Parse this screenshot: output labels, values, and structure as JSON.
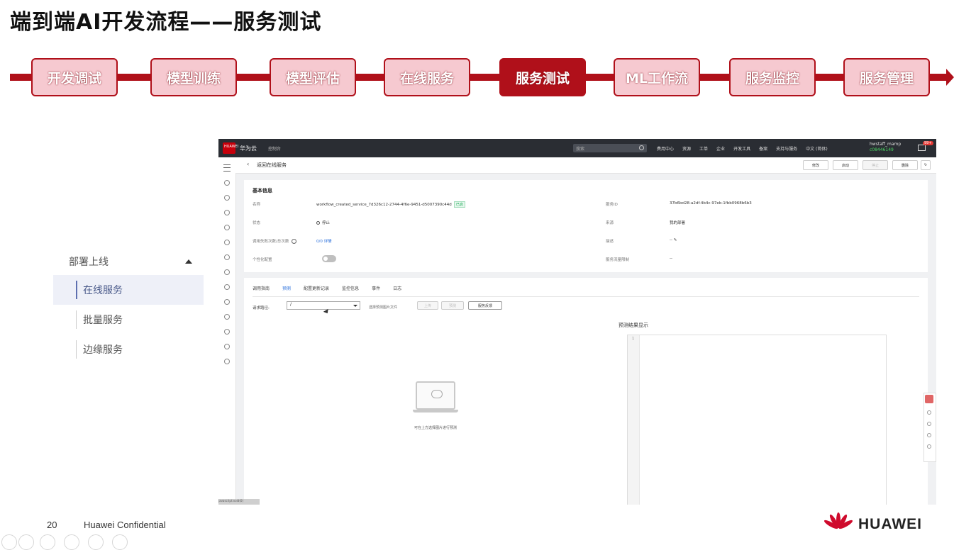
{
  "slide": {
    "title": "端到端AI开发流程——服务测试",
    "page_number": "20",
    "confidential": "Huawei Confidential",
    "brand": "HUAWEI",
    "accent_color": "#b0101a"
  },
  "flow": {
    "steps": [
      {
        "label": "开发调试",
        "active": false
      },
      {
        "label": "模型训练",
        "active": false
      },
      {
        "label": "模型评估",
        "active": false
      },
      {
        "label": "在线服务",
        "active": false
      },
      {
        "label": "服务测试",
        "active": true
      },
      {
        "label": "ML工作流",
        "active": false
      },
      {
        "label": "服务监控",
        "active": false
      },
      {
        "label": "服务管理",
        "active": false
      }
    ]
  },
  "side_nav": {
    "section": "部署上线",
    "items": [
      "在线服务",
      "批量服务",
      "边缘服务"
    ],
    "active": "在线服务"
  },
  "app": {
    "topbar": {
      "logo_text": "HUAWEI",
      "brand": "华为云",
      "console": "控制台",
      "search_placeholder": "搜索",
      "links": [
        "费用中心",
        "资源",
        "工单",
        "企业",
        "开发工具",
        "备案",
        "支持与服务",
        "中文 (简体)"
      ],
      "user": "hwstaff_mamp",
      "user_id": "c08446149",
      "badge": "99+"
    },
    "subheader": {
      "back_label": "返回在线服务",
      "buttons": [
        "修改",
        "启动",
        "停止",
        "删除"
      ]
    },
    "basic_info": {
      "section_title": "基本信息",
      "name_label": "名称",
      "name_value": "workflow_created_service_7d326c12-2744-4f6e-9451-d5007390c44d",
      "name_tag": "已启",
      "status_label": "状态",
      "status_value": "停止",
      "calls_label": "调用失败次数/总次数",
      "calls_value": "0/0",
      "calls_link": "详情",
      "personal_label": "个性化配置",
      "id_label": "服务ID",
      "id_value": "37b6bd28-a2df-4b4c-97eb-1fbb0968b6b3",
      "source_label": "来源",
      "source_value": "我的部署",
      "desc_label": "描述",
      "desc_value": "--",
      "traffic_label": "服务流量限制",
      "traffic_value": "--"
    },
    "tabs": [
      "调用指南",
      "预测",
      "配置更新记录",
      "监控信息",
      "事件",
      "日志"
    ],
    "active_tab": "预测",
    "predict": {
      "path_label": "请求路径:",
      "path_value": "/",
      "file_label": "选择预测图片文件",
      "upload_btn": "上传",
      "predict_btn": "预测",
      "feedback_btn": "服务反馈",
      "upload_hint": "可在上方选择图片进行预测",
      "result_title": "预测结果显示",
      "line_number": "1"
    },
    "tooltip_text": "javascript:void(0)"
  }
}
